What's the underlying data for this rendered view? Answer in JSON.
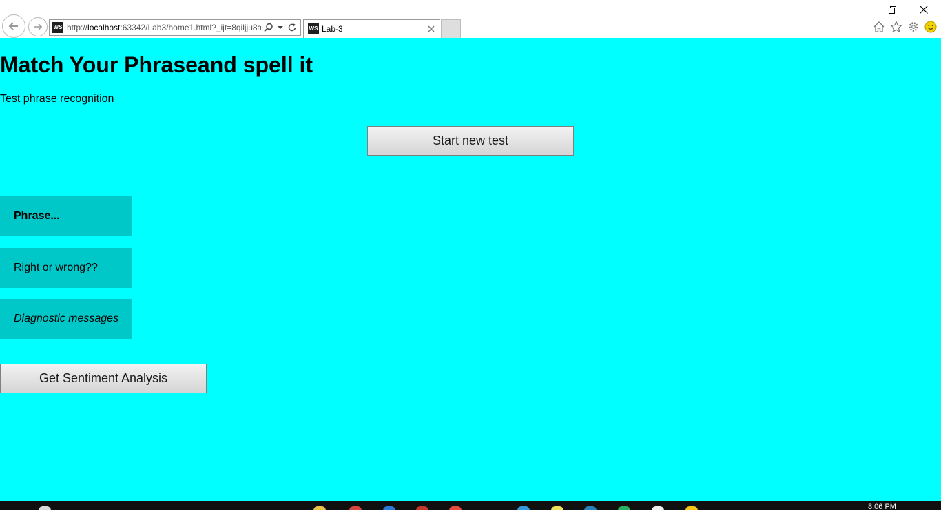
{
  "browser": {
    "address": {
      "url_prefix": "http://",
      "url_host": "localhost",
      "url_rest": ":63342/Lab3/home1.html?_ijt=8qiljju8a"
    },
    "tab": {
      "icon_text": "WS",
      "title": "Lab-3"
    },
    "icons": {
      "back": "back-arrow-icon",
      "forward": "forward-arrow-icon",
      "search": "search-icon",
      "refresh": "refresh-icon",
      "home": "home-icon",
      "favorites": "star-icon",
      "settings": "gear-icon",
      "feedback": "smiley-icon"
    }
  },
  "page": {
    "background_color": "#00ffff",
    "title": "Match Your Phraseand spell it",
    "subtitle": "Test phrase recognition",
    "start_button": "Start new test",
    "phrase_panel": "Phrase...",
    "result_panel": "Right or wrong??",
    "diagnostic_panel": "Diagnostic messages",
    "sentiment_button": "Get Sentiment Analysis",
    "panel_color": "#00c8c8"
  },
  "taskbar": {
    "time": "8:06 PM"
  }
}
